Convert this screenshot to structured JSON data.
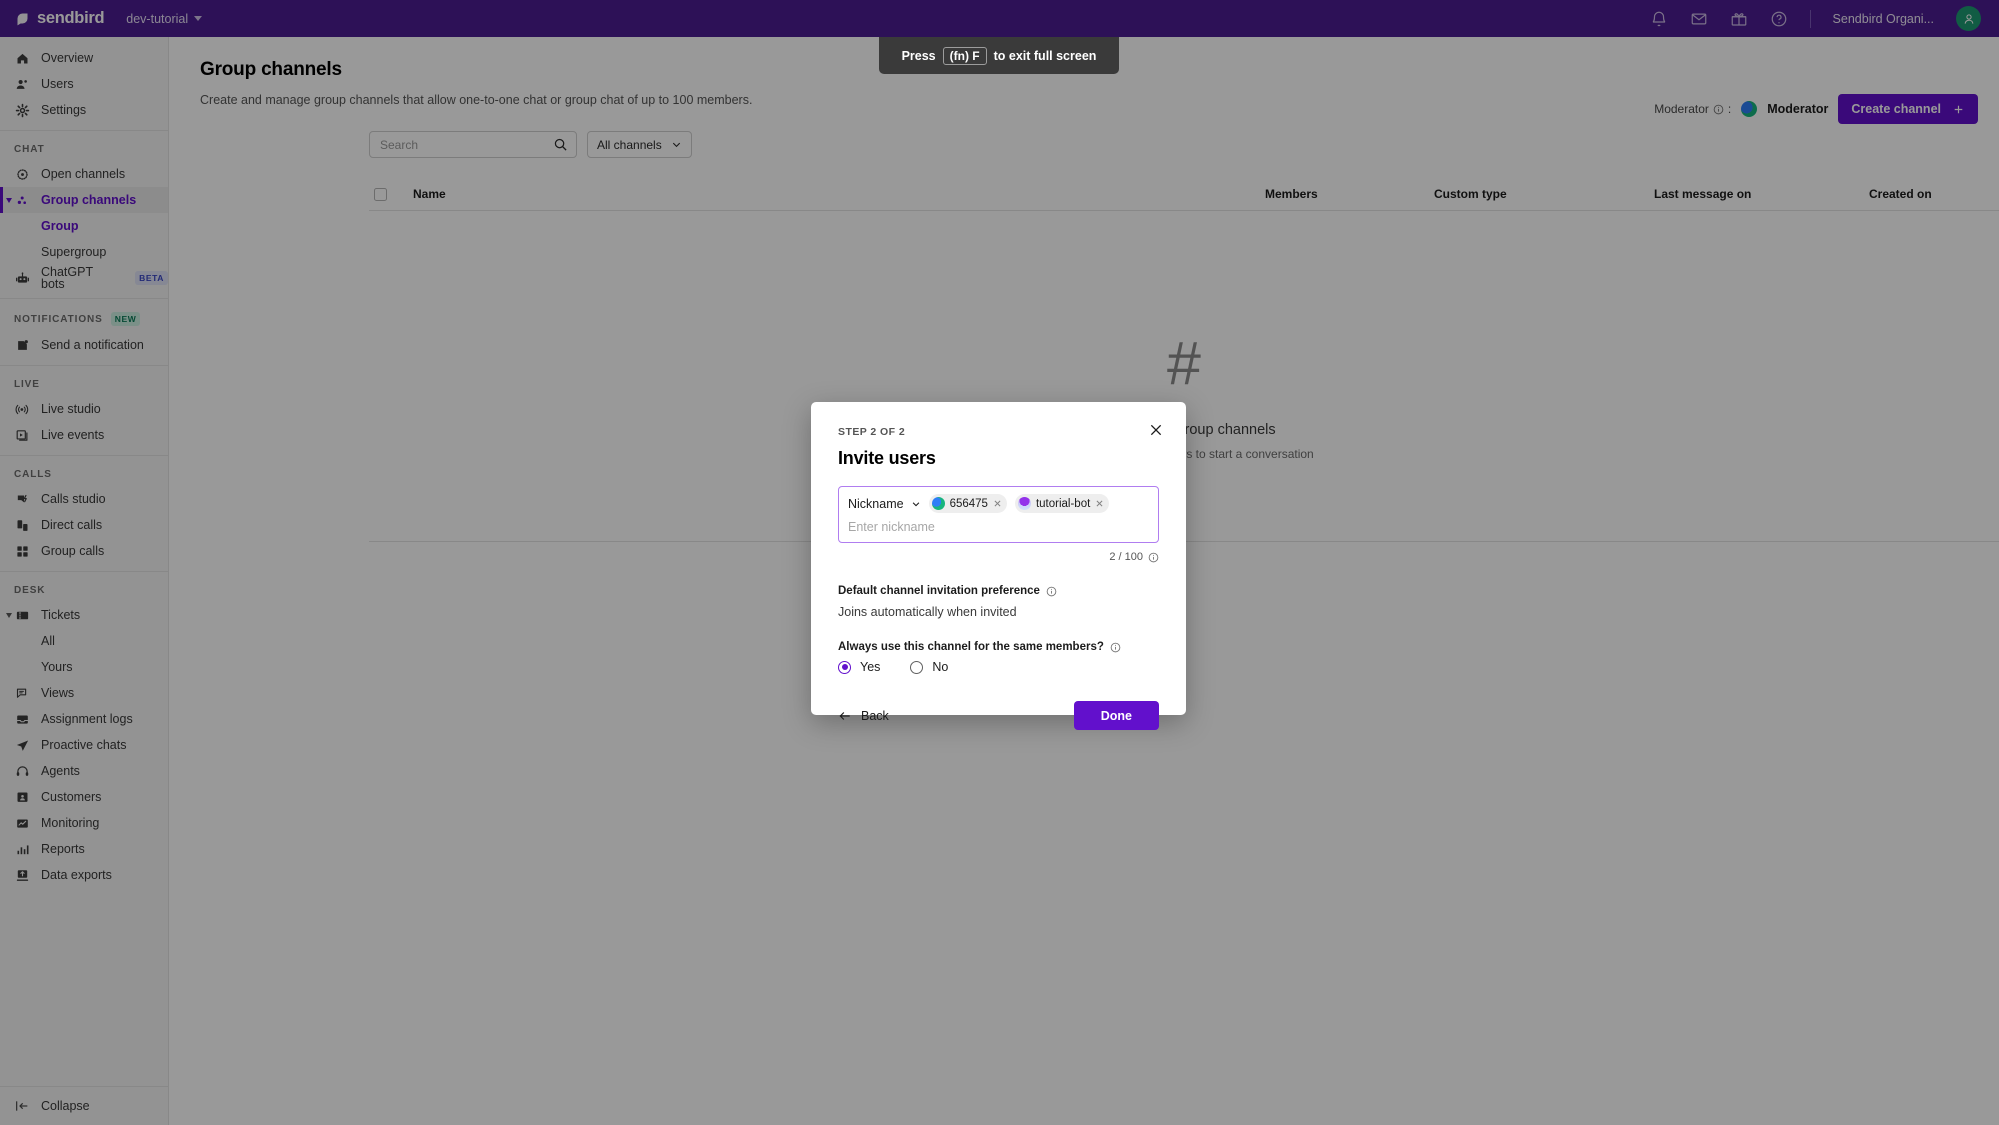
{
  "topbar": {
    "brand": "sendbird",
    "org": "dev-tutorial",
    "icons": [
      "bell-icon",
      "mail-icon",
      "gift-icon",
      "help-icon"
    ],
    "user": "Sendbird Organi..."
  },
  "fullscreen_toast": {
    "prefix": "Press",
    "key": "(fn) F",
    "suffix": "to exit full screen"
  },
  "sidebar": {
    "groups": [
      {
        "title": "",
        "items": [
          {
            "label": "Overview",
            "icon": "home-icon",
            "level": 0,
            "active": false
          },
          {
            "label": "Users",
            "icon": "users-icon",
            "level": 0,
            "active": false
          },
          {
            "label": "Settings",
            "icon": "gear-icon",
            "level": 0,
            "active": false
          }
        ]
      },
      {
        "title": "CHAT",
        "items": [
          {
            "label": "Open channels",
            "icon": "open-channels-icon",
            "level": 0,
            "active": false
          },
          {
            "label": "Group channels",
            "icon": "group-channels-icon",
            "level": 0,
            "active": true,
            "expanded": true
          },
          {
            "label": "Group",
            "icon": "",
            "level": 1,
            "active": false,
            "selected": true
          },
          {
            "label": "Supergroup",
            "icon": "",
            "level": 1,
            "active": false
          },
          {
            "label": "ChatGPT bots",
            "icon": "robot-icon",
            "level": 0,
            "active": false,
            "badge": "BETA"
          }
        ]
      },
      {
        "title": "NOTIFICATIONS",
        "title_badge": "NEW",
        "items": [
          {
            "label": "Send a notification",
            "icon": "send-notification-icon",
            "level": 0,
            "active": false
          }
        ]
      },
      {
        "title": "LIVE",
        "items": [
          {
            "label": "Live studio",
            "icon": "live-studio-icon",
            "level": 0,
            "active": false
          },
          {
            "label": "Live events",
            "icon": "live-events-icon",
            "level": 0,
            "active": false
          }
        ]
      },
      {
        "title": "CALLS",
        "items": [
          {
            "label": "Calls studio",
            "icon": "calls-studio-icon",
            "level": 0,
            "active": false
          },
          {
            "label": "Direct calls",
            "icon": "direct-calls-icon",
            "level": 0,
            "active": false
          },
          {
            "label": "Group calls",
            "icon": "group-calls-icon",
            "level": 0,
            "active": false
          }
        ]
      },
      {
        "title": "DESK",
        "items": [
          {
            "label": "Tickets",
            "icon": "tickets-icon",
            "level": 0,
            "active": false,
            "expanded": true
          },
          {
            "label": "All",
            "icon": "",
            "level": 1,
            "active": false
          },
          {
            "label": "Yours",
            "icon": "",
            "level": 1,
            "active": false
          },
          {
            "label": "Views",
            "icon": "views-icon",
            "level": 0,
            "active": false
          },
          {
            "label": "Assignment logs",
            "icon": "assignment-logs-icon",
            "level": 0,
            "active": false
          },
          {
            "label": "Proactive chats",
            "icon": "proactive-chats-icon",
            "level": 0,
            "active": false
          },
          {
            "label": "Agents",
            "icon": "agents-icon",
            "level": 0,
            "active": false
          },
          {
            "label": "Customers",
            "icon": "customers-icon",
            "level": 0,
            "active": false
          },
          {
            "label": "Monitoring",
            "icon": "monitoring-icon",
            "level": 0,
            "active": false
          },
          {
            "label": "Reports",
            "icon": "reports-icon",
            "level": 0,
            "active": false
          },
          {
            "label": "Data exports",
            "icon": "data-exports-icon",
            "level": 0,
            "active": false
          }
        ]
      }
    ],
    "collapse": "Collapse"
  },
  "page": {
    "title": "Group channels",
    "description": "Create and manage group channels that allow one-to-one chat or group chat of up to 100 members.",
    "moderator_label": "Moderator",
    "moderator_sep": ":",
    "moderator_name": "Moderator",
    "create_channel": "Create channel"
  },
  "toolbar": {
    "search_placeholder": "Search",
    "search_value": "",
    "filter_label": "All channels"
  },
  "table": {
    "columns": [
      "Name",
      "Members",
      "Custom type",
      "Last message on",
      "Created on"
    ]
  },
  "empty_state": {
    "glyph": "#",
    "title": "You have no group channels",
    "subtitle": "Please wait for your users to start a conversation"
  },
  "modal": {
    "step": "STEP 2 OF 2",
    "title": "Invite users",
    "search_type": "Nickname",
    "chips": [
      {
        "name": "656475",
        "avatar_color": "#17b57e"
      },
      {
        "name": "tutorial-bot",
        "avatar_color": "#a855f7"
      }
    ],
    "input_placeholder": "Enter nickname",
    "counter": "2 / 100",
    "pref_label": "Default channel invitation preference",
    "pref_value": "Joins automatically when invited",
    "always_label": "Always use this channel for the same members?",
    "radio_options": [
      {
        "label": "Yes",
        "selected": true
      },
      {
        "label": "No",
        "selected": false
      }
    ],
    "back_label": "Back",
    "done_label": "Done"
  },
  "colors": {
    "brand_purple": "#4c1d92",
    "accent_purple": "#6210cc",
    "avatar_green": "#1d9a72"
  }
}
